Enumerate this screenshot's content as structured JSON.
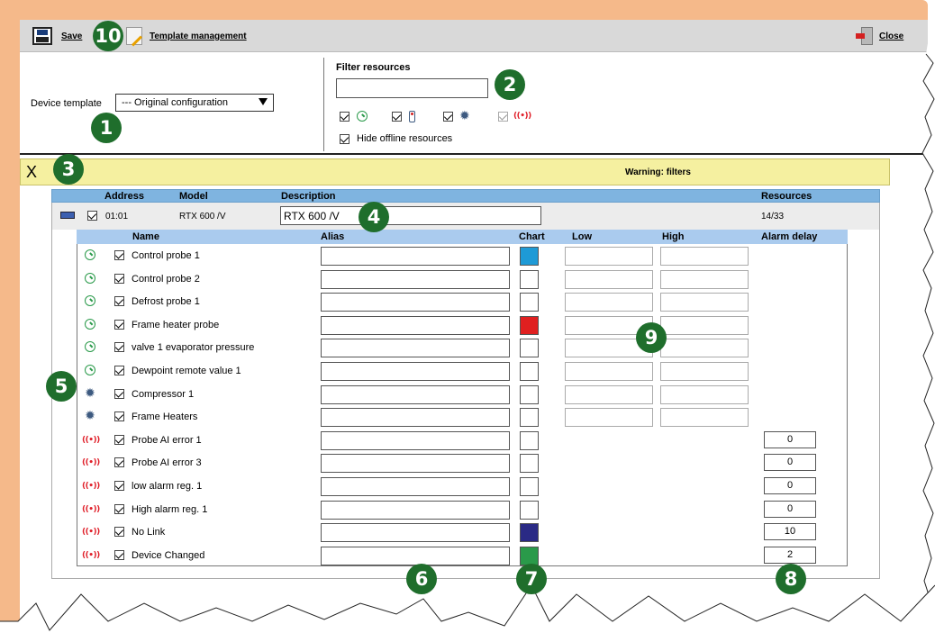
{
  "colors": {
    "frame_orange": "#f5b98a",
    "toolbar_bg": "#d9d9d9",
    "warning_bg": "#f5f0a0",
    "header_blue": "#7fb4e0",
    "subheader_blue": "#aacbee",
    "badge_green": "#1f6e2c"
  },
  "toolbar": {
    "save_label": "Save",
    "template_label": "Template management",
    "close_label": "Close"
  },
  "device_template": {
    "label": "Device template",
    "selected": "--- Original configuration"
  },
  "filter": {
    "title": "Filter resources",
    "search_value": "",
    "types": [
      {
        "icon": "analog-probe-icon",
        "checked": true
      },
      {
        "icon": "digital-icon",
        "checked": true
      },
      {
        "icon": "gear-icon",
        "checked": true
      },
      {
        "icon": "alarm-icon",
        "checked": true
      }
    ],
    "hide_offline_label": "Hide offline resources",
    "hide_offline_checked": true
  },
  "warning": {
    "close_glyph": "X",
    "text": "Warning: filters"
  },
  "device_table": {
    "headers": {
      "address": "Address",
      "model": "Model",
      "description": "Description",
      "resources": "Resources"
    },
    "row": {
      "address": "01:01",
      "model": "RTX 600 /V",
      "description": "RTX 600 /V",
      "resources": "14/33",
      "checked": true
    }
  },
  "resource_table": {
    "headers": {
      "name": "Name",
      "alias": "Alias",
      "chart": "Chart",
      "low": "Low",
      "high": "High",
      "alarm_delay": "Alarm delay"
    },
    "rows": [
      {
        "icon": "analog-probe-icon",
        "name": "Control probe 1",
        "chart_color": "#1e9ad6",
        "thresholds": true,
        "delay": ""
      },
      {
        "icon": "analog-probe-icon",
        "name": "Control probe 2",
        "chart_color": "",
        "thresholds": true,
        "delay": ""
      },
      {
        "icon": "analog-probe-icon",
        "name": "Defrost probe 1",
        "chart_color": "",
        "thresholds": true,
        "delay": ""
      },
      {
        "icon": "analog-probe-icon",
        "name": "Frame heater probe",
        "chart_color": "#e02020",
        "thresholds": true,
        "delay": ""
      },
      {
        "icon": "analog-probe-icon",
        "name": "valve 1 evaporator pressure",
        "chart_color": "",
        "thresholds": true,
        "delay": ""
      },
      {
        "icon": "analog-probe-icon",
        "name": "Dewpoint remote value 1",
        "chart_color": "",
        "thresholds": true,
        "delay": ""
      },
      {
        "icon": "gear-icon",
        "name": "Compressor 1",
        "chart_color": "",
        "thresholds": true,
        "delay": ""
      },
      {
        "icon": "gear-icon",
        "name": "Frame Heaters",
        "chart_color": "",
        "thresholds": true,
        "delay": ""
      },
      {
        "icon": "alarm-icon",
        "name": "Probe AI error 1",
        "chart_color": "",
        "thresholds": false,
        "delay": "0"
      },
      {
        "icon": "alarm-icon",
        "name": "Probe AI error 3",
        "chart_color": "",
        "thresholds": false,
        "delay": "0"
      },
      {
        "icon": "alarm-icon",
        "name": "low alarm reg. 1",
        "chart_color": "",
        "thresholds": false,
        "delay": "0"
      },
      {
        "icon": "alarm-icon",
        "name": "High alarm reg. 1",
        "chart_color": "",
        "thresholds": false,
        "delay": "0"
      },
      {
        "icon": "alarm-icon",
        "name": "No Link",
        "chart_color": "#2a2a85",
        "thresholds": false,
        "delay": "10"
      },
      {
        "icon": "alarm-icon",
        "name": "Device Changed",
        "chart_color": "#2a9a4a",
        "thresholds": false,
        "delay": "2"
      }
    ]
  },
  "callouts": [
    "10",
    "2",
    "1",
    "3",
    "4",
    "5",
    "9",
    "6",
    "7",
    "8"
  ]
}
